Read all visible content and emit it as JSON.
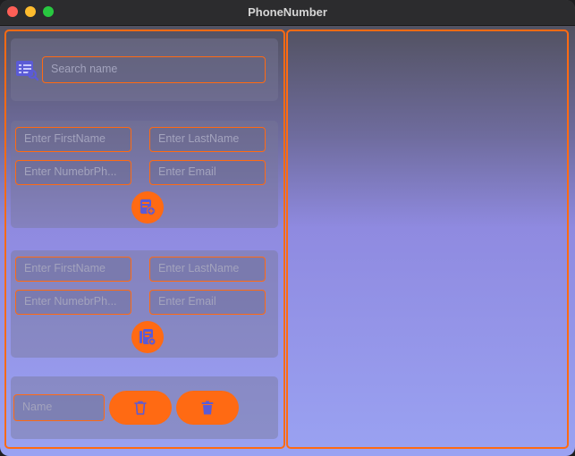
{
  "window": {
    "title": "PhoneNumber"
  },
  "search": {
    "placeholder": "Search name"
  },
  "add_form": {
    "first_name_placeholder": "Enter FirstName",
    "last_name_placeholder": "Enter LastName",
    "phone_placeholder": "Enter NumebrPh...",
    "email_placeholder": "Enter Email",
    "submit_icon": "contact-add-icon"
  },
  "edit_form": {
    "first_name_placeholder": "Enter FirstName",
    "last_name_placeholder": "Enter LastName",
    "phone_placeholder": "Enter NumebrPh...",
    "email_placeholder": "Enter Email",
    "submit_icon": "contact-edit-icon"
  },
  "delete_form": {
    "name_placeholder": "Name",
    "delete_outline_icon": "trash-outline-icon",
    "delete_filled_icon": "trash-filled-icon"
  },
  "colors": {
    "accent": "#ff6a13",
    "icon": "#5b5bd6",
    "placeholder_text": "#a3a3bd"
  }
}
